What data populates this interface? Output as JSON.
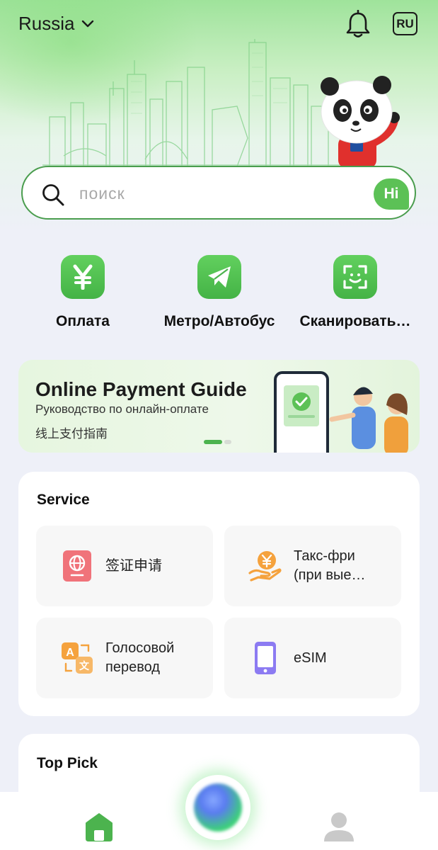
{
  "header": {
    "region": "Russia",
    "language_badge": "RU",
    "icons": {
      "region_dropdown": "chevron-down-icon",
      "notifications": "bell-icon"
    }
  },
  "search": {
    "placeholder": "поиск",
    "assistant_badge": "Hi"
  },
  "quick_actions": [
    {
      "label": "Оплата",
      "icon": "yuan-icon"
    },
    {
      "label": "Метро/Автобус",
      "icon": "paper-plane-icon"
    },
    {
      "label": "Сканировать…",
      "icon": "scan-icon"
    }
  ],
  "banner": {
    "title": "Online Payment Guide",
    "subtitle_ru": "Руководство по онлайн-оплате",
    "subtitle_zh": "线上支付指南",
    "carousel": {
      "active_index": 0,
      "count": 2
    }
  },
  "service": {
    "title": "Service",
    "items": [
      {
        "lines": [
          "签证申请"
        ],
        "icon": "passport-icon"
      },
      {
        "lines": [
          "Такс-фри",
          "(при вые…"
        ],
        "icon": "tax-free-icon"
      },
      {
        "lines": [
          "Голосовой",
          "перевод"
        ],
        "icon": "translate-icon"
      },
      {
        "lines": [
          "eSIM"
        ],
        "icon": "mobile-phone-icon"
      }
    ]
  },
  "top_pick": {
    "title": "Top Pick"
  },
  "tabbar": {
    "items": [
      {
        "name": "home",
        "icon": "home-icon",
        "active": true
      },
      {
        "name": "assistant",
        "icon": "ai-orb-icon"
      },
      {
        "name": "profile",
        "icon": "user-icon"
      }
    ]
  },
  "colors": {
    "brand_green": "#4cb34e",
    "icon_green": "#5cc156",
    "passport_red": "#f0737a",
    "tax_orange": "#f5a23d",
    "esim_purple": "#8c7bf2",
    "page_bg": "#eef0f8"
  }
}
